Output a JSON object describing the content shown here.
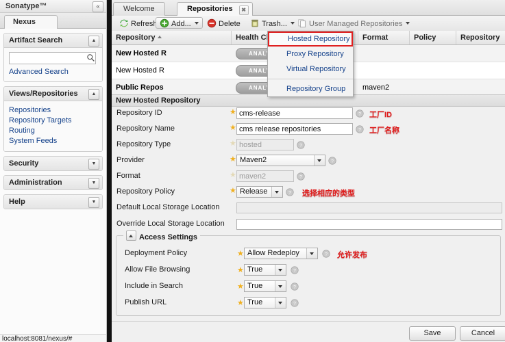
{
  "sidebar": {
    "brand": "Sonatype™",
    "collapse_icon": "chevron-double-left-icon",
    "tab_label": "Nexus",
    "sections": [
      {
        "title": "Artifact Search",
        "toggle": "collapse-up-icon"
      },
      {
        "title": "Views/Repositories",
        "toggle": "collapse-up-icon"
      },
      {
        "title": "Security",
        "toggle": "expand-down-icon"
      },
      {
        "title": "Administration",
        "toggle": "expand-down-icon"
      },
      {
        "title": "Help",
        "toggle": "expand-down-icon"
      }
    ],
    "search": {
      "value": "",
      "placeholder": "",
      "icon": "search-icon"
    },
    "advanced_search": "Advanced Search",
    "nav_links": [
      "Repositories",
      "Repository Targets",
      "Routing",
      "System Feeds"
    ]
  },
  "status_bar": {
    "text": "localhost:8081/nexus/#"
  },
  "main": {
    "tabs": [
      {
        "label": "Welcome",
        "active": false,
        "closable": false
      },
      {
        "label": "Repositories",
        "active": true,
        "closable": true
      }
    ],
    "toolbar": [
      {
        "label": "Refresh",
        "icon": "refresh-icon",
        "caret": false,
        "selected": false
      },
      {
        "label": "Add...",
        "icon": "add-plus-icon",
        "caret": true,
        "selected": true
      },
      {
        "label": "Delete",
        "icon": "delete-minus-icon",
        "caret": false,
        "selected": false
      },
      {
        "label": "Trash...",
        "icon": "trash-icon",
        "caret": true,
        "selected": false
      },
      {
        "label": "User Managed Repositories",
        "icon": "copy-pages-icon",
        "caret": true,
        "selected": false
      }
    ],
    "add_menu": {
      "items": [
        "Hosted Repository",
        "Proxy Repository",
        "Virtual Repository"
      ],
      "group_item": "Repository Group",
      "highlighted": "Hosted Repository",
      "highlight_color": "#e02020"
    },
    "grid": {
      "columns": [
        "Repository",
        "Health Check",
        "Format",
        "Policy",
        "Repository Status"
      ],
      "sort_column": "Repository",
      "sort_dir": "asc",
      "rows": [
        {
          "repository": "New Hosted R",
          "health": "ANALYZE",
          "format": "",
          "policy": "",
          "status": ""
        },
        {
          "repository": "New Hosted R",
          "health": "ANALYZE",
          "format": "",
          "policy": "",
          "status": ""
        },
        {
          "repository": "Public Repos",
          "health": "ANALYZE",
          "format": "maven2",
          "policy": "",
          "status": ""
        }
      ]
    },
    "form": {
      "title": "New Hosted Repository",
      "fields": [
        {
          "label": "Repository ID",
          "value": "cms-release",
          "kind": "text",
          "required": true,
          "disabled": false,
          "note": "工厂ID"
        },
        {
          "label": "Repository Name",
          "value": "cms release repositories",
          "kind": "text",
          "required": true,
          "disabled": false,
          "note": "工厂名称"
        },
        {
          "label": "Repository Type",
          "value": "hosted",
          "kind": "text",
          "required": true,
          "disabled": true,
          "note": ""
        },
        {
          "label": "Provider",
          "value": "Maven2",
          "kind": "select",
          "required": true,
          "disabled": false,
          "note": ""
        },
        {
          "label": "Format",
          "value": "maven2",
          "kind": "text",
          "required": true,
          "disabled": true,
          "note": ""
        },
        {
          "label": "Repository Policy",
          "value": "Release",
          "kind": "select",
          "required": true,
          "disabled": false,
          "note": "选择相应的类型"
        },
        {
          "label": "Default Local Storage Location",
          "value": "",
          "kind": "wide",
          "required": false,
          "disabled": true,
          "note": ""
        },
        {
          "label": "Override Local Storage Location",
          "value": "",
          "kind": "wide",
          "required": false,
          "disabled": false,
          "note": ""
        }
      ],
      "access_settings": {
        "legend": "Access Settings",
        "rows": [
          {
            "label": "Deployment Policy",
            "value": "Allow Redeploy",
            "note": "允许发布"
          },
          {
            "label": "Allow File Browsing",
            "value": "True",
            "note": ""
          },
          {
            "label": "Include in Search",
            "value": "True",
            "note": ""
          },
          {
            "label": "Publish URL",
            "value": "True",
            "note": ""
          }
        ]
      }
    },
    "footer": {
      "save_label": "Save",
      "cancel_label": "Cancel"
    }
  }
}
